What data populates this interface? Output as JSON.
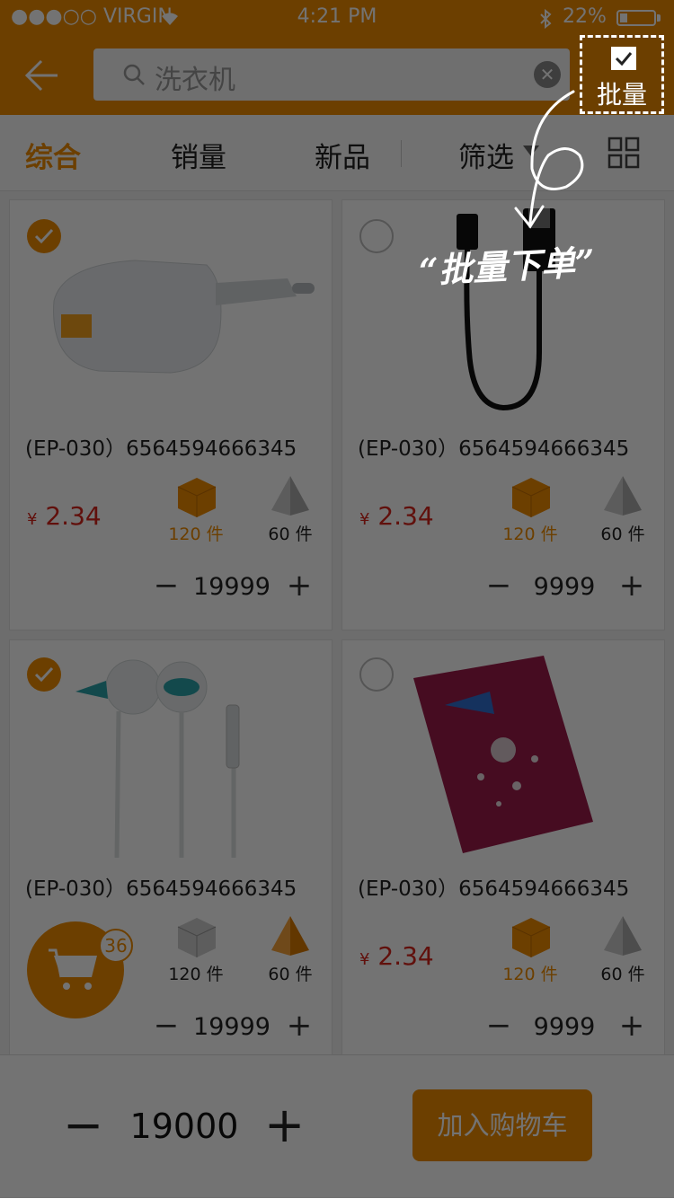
{
  "status_bar": {
    "carrier": "●●●○○ VIRGIN",
    "time": "4:21 PM",
    "battery": "22%",
    "battery_level": 0.22
  },
  "header": {
    "search_text": "洗衣机",
    "batch_label": "批量"
  },
  "filters": [
    "综合",
    "销量",
    "新品",
    "筛选"
  ],
  "products": [
    {
      "name": "(EP-030）6564594666345",
      "price": "2.34",
      "currency": "¥",
      "selected": true,
      "image": "charger",
      "qty_a": "120 件",
      "qty_b": "60 件",
      "qty_a_highlight": true,
      "qty_b_highlight": false,
      "count": "19999"
    },
    {
      "name": "(EP-030）6564594666345",
      "price": "2.34",
      "currency": "¥",
      "selected": false,
      "image": "usb-cable",
      "qty_a": "120 件",
      "qty_b": "60 件",
      "qty_a_highlight": true,
      "qty_b_highlight": false,
      "count": "9999"
    },
    {
      "name": "(EP-030）6564594666345",
      "price": "",
      "currency": "",
      "selected": true,
      "image": "earphones",
      "qty_a": "120 件",
      "qty_b": "60 件",
      "qty_a_highlight": false,
      "qty_b_highlight": true,
      "count": "19999"
    },
    {
      "name": "(EP-030）6564594666345",
      "price": "2.34",
      "currency": "¥",
      "selected": false,
      "image": "notebook",
      "qty_a": "120 件",
      "qty_b": "60 件",
      "qty_a_highlight": true,
      "qty_b_highlight": false,
      "count": "9999"
    }
  ],
  "cart": {
    "badge": "36"
  },
  "bottom": {
    "quantity": "19000",
    "add_to_cart": "加入购物车"
  },
  "overlay": {
    "hint": "“批量下单”"
  },
  "colors": {
    "accent": "#f08c00",
    "price": "#d8241b"
  }
}
